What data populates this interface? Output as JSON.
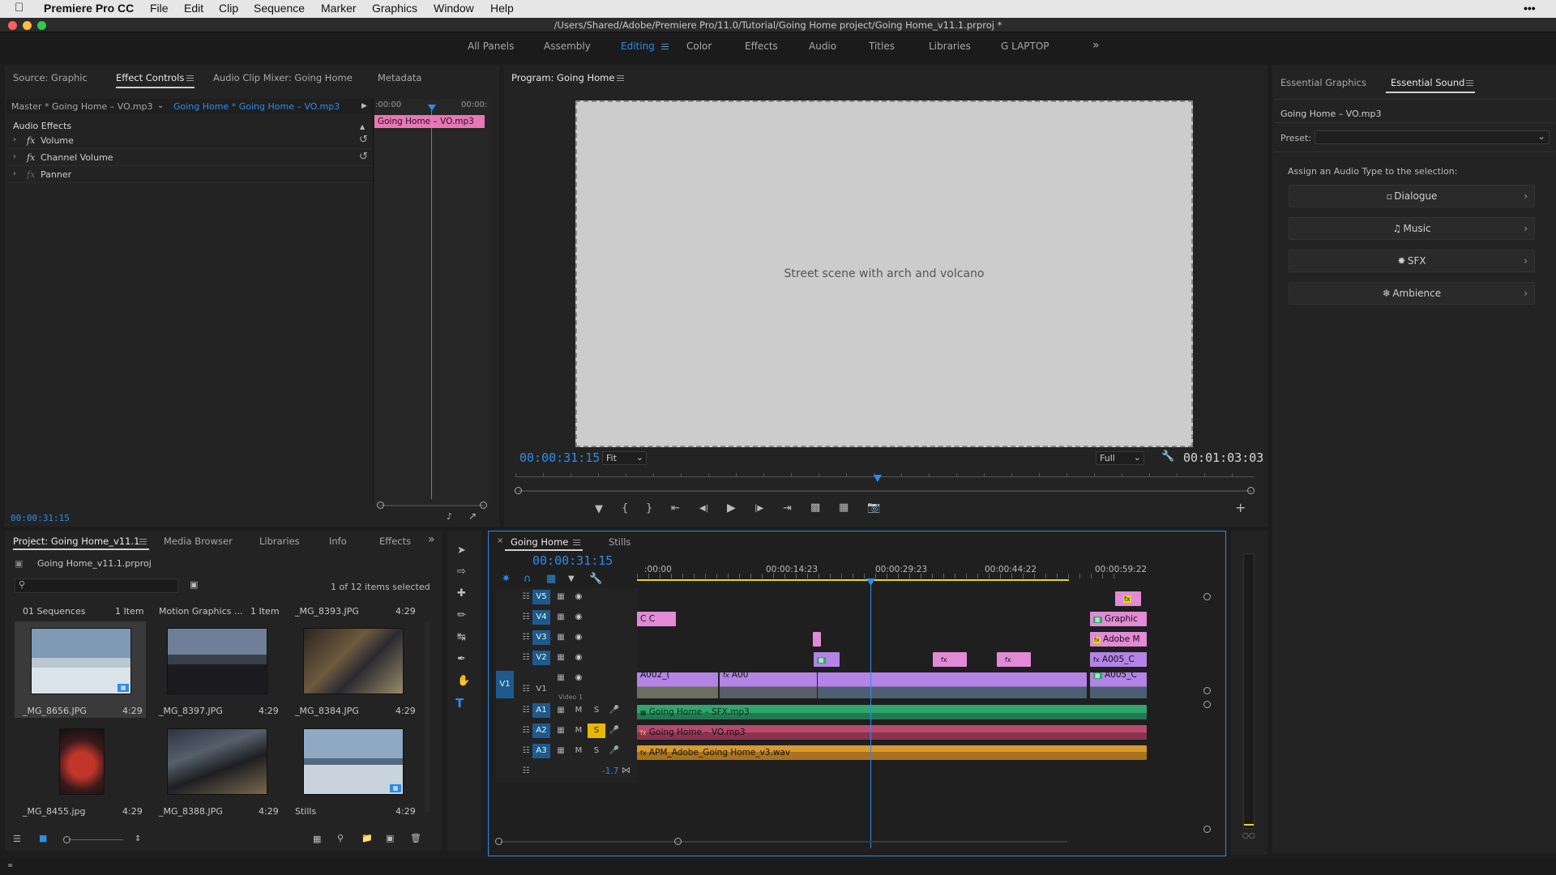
{
  "menubar": {
    "app_name": "Premiere Pro CC",
    "items": [
      "File",
      "Edit",
      "Clip",
      "Sequence",
      "Marker",
      "Graphics",
      "Window",
      "Help"
    ]
  },
  "window_title": "/Users/Shared/Adobe/Premiere Pro/11.0/Tutorial/Going Home project/Going Home_v11.1.prproj *",
  "workspaces": [
    "All Panels",
    "Assembly",
    "Editing",
    "Color",
    "Effects",
    "Audio",
    "Titles",
    "Libraries",
    "G LAPTOP"
  ],
  "workspace_active": "Editing",
  "source_panel": {
    "tabs": [
      "Source: Graphic",
      "Effect Controls",
      "Audio Clip Mixer: Going Home",
      "Metadata"
    ],
    "master_label": "Master * Going Home – VO.mp3",
    "clip_label": "Going Home * Going Home – VO.mp3",
    "ruler_start": ":00:00",
    "ruler_end": "00:00:",
    "clip_bar_label": "Going Home – VO.mp3",
    "section": "Audio Effects",
    "effects": [
      "Volume",
      "Channel Volume",
      "Panner"
    ],
    "timecode": "00:00:31:15"
  },
  "program": {
    "title": "Program: Going Home",
    "timecode": "00:00:31:15",
    "fit": "Fit",
    "quality": "Full",
    "duration": "00:01:03:03",
    "playhead_fraction": 0.49
  },
  "essential_sound": {
    "tabs": [
      "Essential Graphics",
      "Essential Sound"
    ],
    "clip_name": "Going Home – VO.mp3",
    "preset_label": "Preset:",
    "assign_text": "Assign an Audio Type to the selection:",
    "types": [
      "Dialogue",
      "Music",
      "SFX",
      "Ambience"
    ]
  },
  "project": {
    "tabs": [
      "Project: Going Home_v11.1",
      "Media Browser",
      "Libraries",
      "Info",
      "Effects"
    ],
    "file_name": "Going Home_v11.1.prproj",
    "selection_count": "1 of 12 items selected",
    "bins": [
      {
        "name": "01 Sequences",
        "count": "1 Item"
      },
      {
        "name": "Motion Graphics ...",
        "count": "1 Item"
      },
      {
        "name": "_MG_8393.JPG",
        "count": "4:29"
      }
    ],
    "items": [
      {
        "name": "_MG_8656.JPG",
        "duration": "4:29"
      },
      {
        "name": "_MG_8397.JPG",
        "duration": "4:29"
      },
      {
        "name": "_MG_8384.JPG",
        "duration": "4:29"
      },
      {
        "name": "_MG_8455.jpg",
        "duration": "4:29"
      },
      {
        "name": "_MG_8388.JPG",
        "duration": "4:29"
      },
      {
        "name": "Stills",
        "duration": "4:29"
      }
    ]
  },
  "timeline": {
    "tabs": [
      "Going Home",
      "Stills"
    ],
    "timecode": "00:00:31:15",
    "ruler": [
      ":00:00",
      "00:00:14:23",
      "00:00:29:23",
      "00:00:44:22",
      "00:00:59:22"
    ],
    "video_tracks": [
      "V5",
      "V4",
      "V3",
      "V2",
      "V1"
    ],
    "v1_label": "V1",
    "video_1_name": "Video 1",
    "audio_tracks": [
      "A1",
      "A2",
      "A3"
    ],
    "m_label": "M",
    "s_label": "S",
    "master_value": "-1.7",
    "clips": {
      "v4_graphic": "Graphic",
      "v4_c1": "C",
      "v4_c2": "C",
      "v3_adobe": "Adobe M",
      "v2_a005": "A005_C",
      "v1_a005": "A005_C",
      "v1_a002": "A002_(",
      "v1_a00": "A00",
      "a1": "Going Home – SFX.mp3",
      "a2": "Going Home – VO.mp3",
      "a3": "APM_Adobe_Going Home_v3.wav"
    }
  },
  "colors": {
    "accent_blue": "#2d8ceb",
    "video_clip": "#b483e6",
    "graphic_clip": "#e28ad6",
    "sfx_clip": "#2fa66d",
    "vo_clip": "#b84a6d",
    "music_clip": "#d8992e",
    "solo_yellow": "#e6b800",
    "pink_bar": "#e777b5"
  }
}
